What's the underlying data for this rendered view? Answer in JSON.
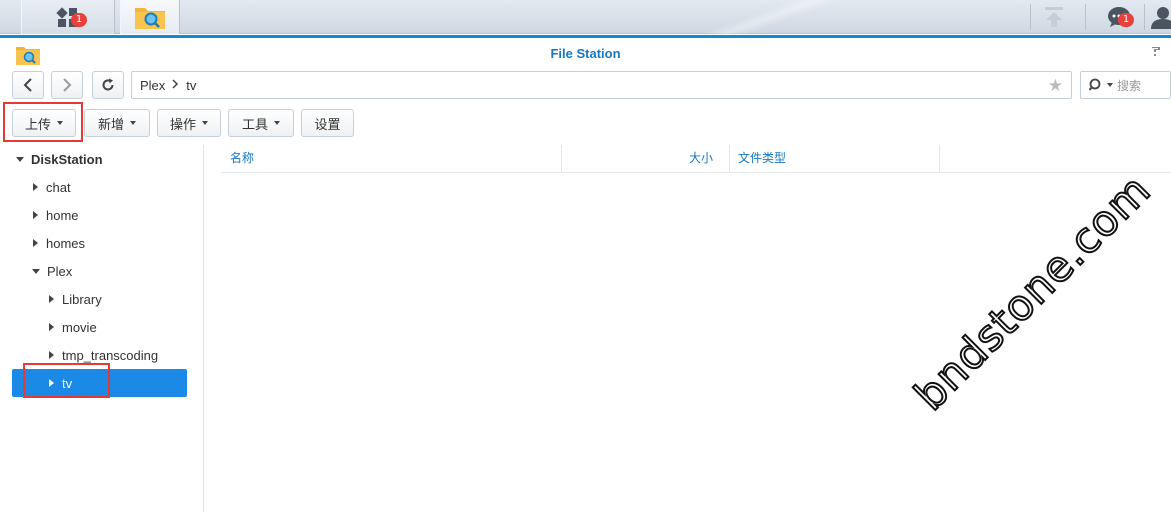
{
  "taskbar": {
    "main_badge": "1",
    "notification_badge": "1"
  },
  "window": {
    "title": "File Station"
  },
  "nav": {
    "path": [
      "Plex",
      "tv"
    ],
    "search_placeholder": "搜索"
  },
  "toolbar": {
    "upload": "上传",
    "create": "新增",
    "action": "操作",
    "tools": "工具",
    "settings": "设置"
  },
  "tree": {
    "root": "DiskStation",
    "items": [
      {
        "label": "chat"
      },
      {
        "label": "home"
      },
      {
        "label": "homes"
      },
      {
        "label": "Plex"
      },
      {
        "label": "Library"
      },
      {
        "label": "movie"
      },
      {
        "label": "tmp_transcoding"
      },
      {
        "label": "tv"
      }
    ]
  },
  "list": {
    "columns": [
      "名称",
      "大小",
      "文件类型"
    ]
  },
  "watermark": "bndstone.com",
  "colors": {
    "accent": "#1588d4",
    "selection": "#1a8ae6",
    "highlight_box": "#e53935"
  }
}
